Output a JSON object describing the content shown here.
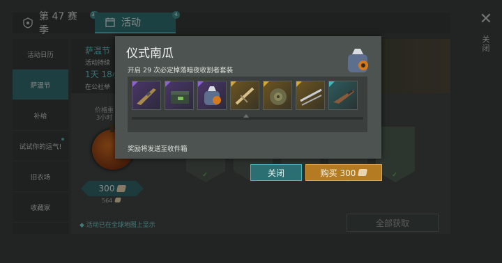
{
  "topbar": {
    "season_label": "第 47 赛季",
    "season_badge": "33",
    "activity_label": "活动",
    "activity_badge": "4"
  },
  "close": {
    "label": "关闭"
  },
  "sidebar": {
    "items": [
      {
        "label": "活动日历"
      },
      {
        "label": "萨温节"
      },
      {
        "label": "补给"
      },
      {
        "label": "试试你的运气!"
      },
      {
        "label": "旧衣场"
      },
      {
        "label": "收藏家"
      }
    ]
  },
  "event": {
    "title": "萨温节",
    "desc": "活动持续",
    "time": "1天 18小",
    "location": "在公社举",
    "price_label_1": "价格重",
    "price_label_2": "3小时",
    "price": "300",
    "small_price": "564",
    "footer_note": "活动已在全球地图上显示",
    "collect_all": "全部获取"
  },
  "modal": {
    "title": "仪式南瓜",
    "subtitle": "开启 29 次必定掉落暗夜收割者套装",
    "reward_note": "奖励将发送至收件箱",
    "items": [
      {
        "icon": "rifle-icon",
        "rarity": "purple"
      },
      {
        "icon": "ammo-box-icon",
        "rarity": "purple"
      },
      {
        "icon": "backpack-icon",
        "rarity": "purple"
      },
      {
        "icon": "crossbow-icon",
        "rarity": "gold"
      },
      {
        "icon": "landmine-icon",
        "rarity": "gold"
      },
      {
        "icon": "rods-icon",
        "rarity": "gold"
      },
      {
        "icon": "shotgun-icon",
        "rarity": "teal"
      }
    ],
    "close_button": "关闭",
    "buy_button": "购买 300"
  },
  "colors": {
    "accent": "#49b8bd",
    "buy": "#b57b23",
    "purple": "#8f62d2",
    "gold": "#d6a53a",
    "teal": "#3fb8bf"
  }
}
